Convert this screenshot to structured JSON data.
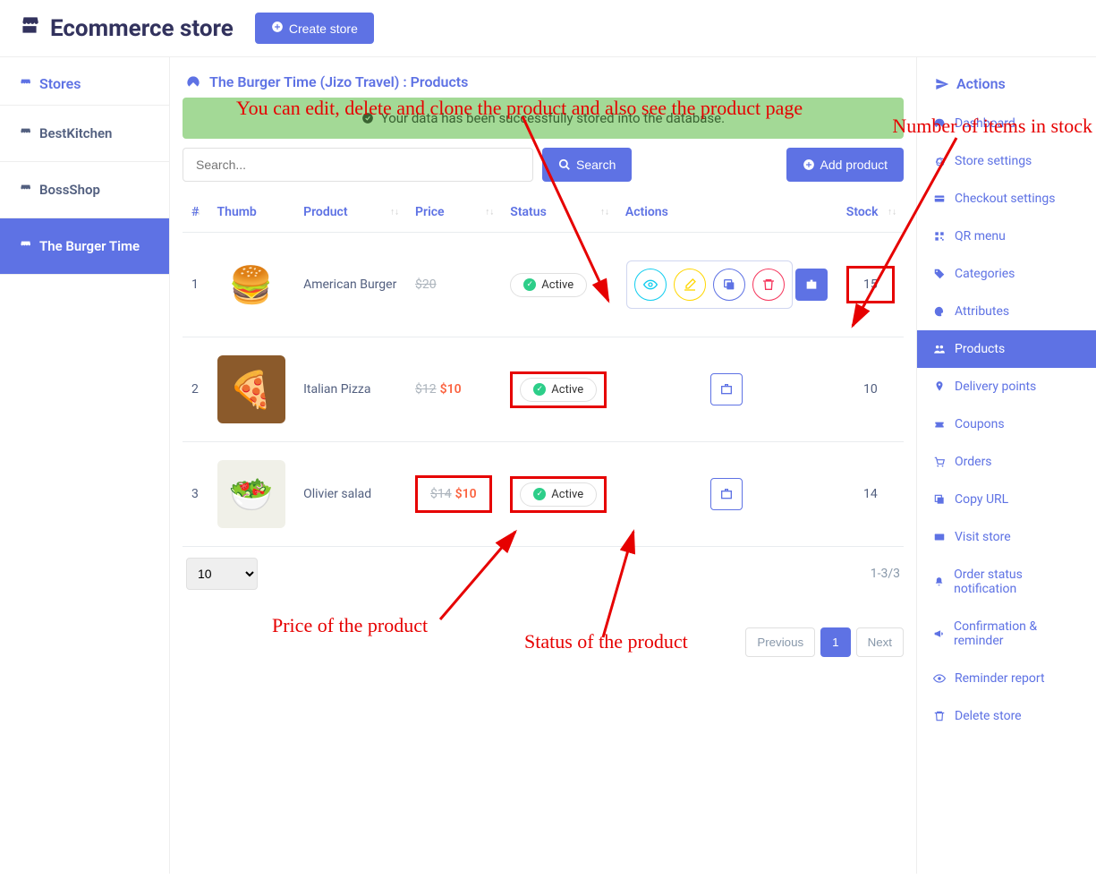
{
  "header": {
    "brand": "Ecommerce store",
    "create_store": "Create store"
  },
  "left_sidebar": {
    "title": "Stores",
    "items": [
      {
        "label": "BestKitchen"
      },
      {
        "label": "BossShop"
      },
      {
        "label": "The Burger Time"
      }
    ]
  },
  "page": {
    "title": "The Burger Time (Jizo Travel) : Products",
    "alert": "Your data has been successfully stored into the database.",
    "search_placeholder": "Search...",
    "search_btn": "Search",
    "add_btn": "Add product"
  },
  "annotations": {
    "actions": "You can edit, delete and clone the product and also see the product page",
    "stock": "Number of items in stock",
    "price": "Price of the product",
    "status": "Status of the product"
  },
  "table": {
    "headers": {
      "num": "#",
      "thumb": "Thumb",
      "product": "Product",
      "price": "Price",
      "status": "Status",
      "actions": "Actions",
      "stock": "Stock"
    },
    "rows": [
      {
        "num": "1",
        "name": "American Burger",
        "thumb_emoji": "🍔",
        "thumb_bg": "#fff",
        "price_old": "$20",
        "price_new": "",
        "status": "Active",
        "stock": "15",
        "highlight_stock": true,
        "show_action_icons": true,
        "highlight_status": false,
        "highlight_price": false
      },
      {
        "num": "2",
        "name": "Italian Pizza",
        "thumb_emoji": "🍕",
        "thumb_bg": "#8b5a2b",
        "price_old": "$12",
        "price_new": "$10",
        "status": "Active",
        "stock": "10",
        "highlight_stock": false,
        "show_action_icons": false,
        "highlight_status": true,
        "highlight_price": false
      },
      {
        "num": "3",
        "name": "Olivier salad",
        "thumb_emoji": "🥗",
        "thumb_bg": "#f0f0e8",
        "price_old": "$14",
        "price_new": "$10",
        "status": "Active",
        "stock": "14",
        "highlight_stock": false,
        "show_action_icons": false,
        "highlight_status": true,
        "highlight_price": true
      }
    ]
  },
  "footer": {
    "page_size": "10",
    "range": "1-3/3",
    "prev": "Previous",
    "page": "1",
    "next": "Next"
  },
  "right_sidebar": {
    "title": "Actions",
    "items": [
      {
        "label": "Dashboard",
        "icon": "tachometer"
      },
      {
        "label": "Store settings",
        "icon": "gear"
      },
      {
        "label": "Checkout settings",
        "icon": "card"
      },
      {
        "label": "QR menu",
        "icon": "qr"
      },
      {
        "label": "Categories",
        "icon": "tag"
      },
      {
        "label": "Attributes",
        "icon": "palette"
      },
      {
        "label": "Products",
        "icon": "users",
        "active": true
      },
      {
        "label": "Delivery points",
        "icon": "pin"
      },
      {
        "label": "Coupons",
        "icon": "ticket"
      },
      {
        "label": "Orders",
        "icon": "cart"
      },
      {
        "label": "Copy URL",
        "icon": "copy"
      },
      {
        "label": "Visit store",
        "icon": "card2"
      },
      {
        "label": "Order status notification",
        "icon": "bell"
      },
      {
        "label": "Confirmation & reminder",
        "icon": "bullhorn"
      },
      {
        "label": "Reminder report",
        "icon": "eye"
      },
      {
        "label": "Delete store",
        "icon": "trash"
      }
    ]
  }
}
